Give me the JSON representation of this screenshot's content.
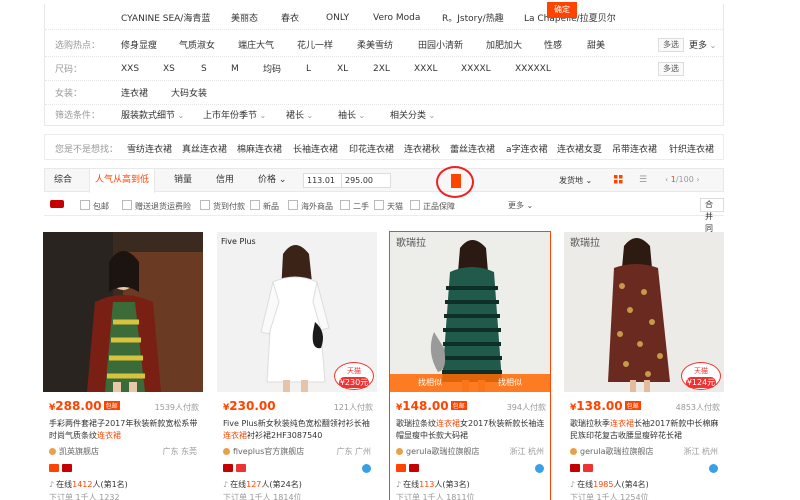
{
  "filters": {
    "brand_row": [
      "CYANINE SEA/海青蓝",
      "美丽态",
      "春衣",
      "ONLY",
      "Vero Moda",
      "R。Jstory/热趣",
      "La Chapelle/拉夏贝尔"
    ],
    "confirm_label": "确定",
    "hot": {
      "label": "选购热点：",
      "items": [
        "修身显瘦",
        "气质淑女",
        "端庄大气",
        "花儿一样",
        "柔美雪纺",
        "田园小清新",
        "加肥加大",
        "性感",
        "甜美"
      ],
      "multi": "多选",
      "more": "更多"
    },
    "size": {
      "label": "尺码：",
      "items": [
        "XXS",
        "XS",
        "S",
        "M",
        "均码",
        "L",
        "XL",
        "2XL",
        "XXXL",
        "XXXXL",
        "XXXXXL"
      ],
      "multi": "多选"
    },
    "womens": {
      "label": "女装：",
      "items": [
        "连衣裙",
        "大码女装"
      ]
    },
    "criteria": {
      "label": "筛选条件：",
      "items": [
        "服装款式细节",
        "上市年份季节",
        "裙长",
        "袖长",
        "相关分类"
      ]
    }
  },
  "suggest": {
    "label": "您是不是想找：",
    "items": [
      "雪纺连衣裙",
      "真丝连衣裙",
      "棉麻连衣裙",
      "长袖连衣裙",
      "印花连衣裙",
      "连衣裙秋",
      "蕾丝连衣裙",
      "a字连衣裙",
      "连衣裙女夏",
      "吊带连衣裙",
      "针织连衣裙"
    ]
  },
  "sortbar": {
    "tabs": [
      "综合",
      "人气从高到低",
      "销量",
      "信用",
      "价格"
    ],
    "price_min": "113.01",
    "price_max": "295.00",
    "price_dash": "-",
    "ship_from": "发货地",
    "page_current": "1",
    "page_total": "/100"
  },
  "checks": {
    "items": [
      "包邮",
      "赠送退货运费险",
      "货到付款",
      "新品",
      "海外商品",
      "二手",
      "天猫",
      "正品保障"
    ],
    "more": "更多",
    "merge": "合并同款宝贝"
  },
  "products": [
    {
      "price": "288.00",
      "sold": "1539人付款",
      "title_pre": "手彩两件套裙子2017年秋装新款宽松系带时尚气质条纹",
      "title_kw": "连衣裙",
      "title_post": "",
      "shop": "凯英旗舰店",
      "loc": "广东 东莞",
      "online_pre": "在线",
      "online_num": "1412",
      "online_post": "人(第1名)",
      "trunc": "下订单 1千人 1232"
    },
    {
      "price": "230.00",
      "sold": "121人付款",
      "title_pre": "Five Plus新女秋装纯色宽松翻领衬衫长袖",
      "title_kw": "连衣裙",
      "title_post": "衬衫裙2HF3087540",
      "shop": "fiveplus官方旗舰店",
      "loc": "广东 广州",
      "online_pre": "在线",
      "online_num": "127",
      "online_post": "人(第24名)",
      "trunc": "下订单 1千人 1814位",
      "badge_top": "天猫",
      "badge_price": "¥230元",
      "brand": "Five Plus"
    },
    {
      "price": "148.00",
      "sold": "394人付款",
      "title_pre": "歌瑞拉条纹",
      "title_kw": "连衣裙",
      "title_post": "女2017秋装新款长袖连帽显瘦中长款大码裙",
      "shop": "gerula歌瑞拉旗舰店",
      "loc": "浙江 杭州",
      "online_pre": "在线",
      "online_num": "113",
      "online_post": "人(第3名)",
      "trunc": "下订单 1千人 1811位",
      "find_sim": "找相似",
      "find_sim2": "找相似",
      "brand": "歌瑞拉"
    },
    {
      "price": "138.00",
      "sold": "4853人付款",
      "title_pre": "歌瑞拉秋季",
      "title_kw": "连衣裙",
      "title_post": "长袖2017新款中长棉麻民族印花复古收腰显瘦碎花长裙",
      "shop": "gerula歌瑞拉旗舰店",
      "loc": "浙江 杭州",
      "online_pre": "在线",
      "online_num": "1985",
      "online_post": "人(第4名)",
      "trunc": "下订单 1千人 1254位",
      "badge_top": "天猫",
      "badge_price": "¥124元",
      "brand": "歌瑞拉"
    }
  ],
  "currency": "¥",
  "baoyou": "包邮",
  "colors": {
    "accent": "#ff4400",
    "tmall": "#c40000"
  }
}
